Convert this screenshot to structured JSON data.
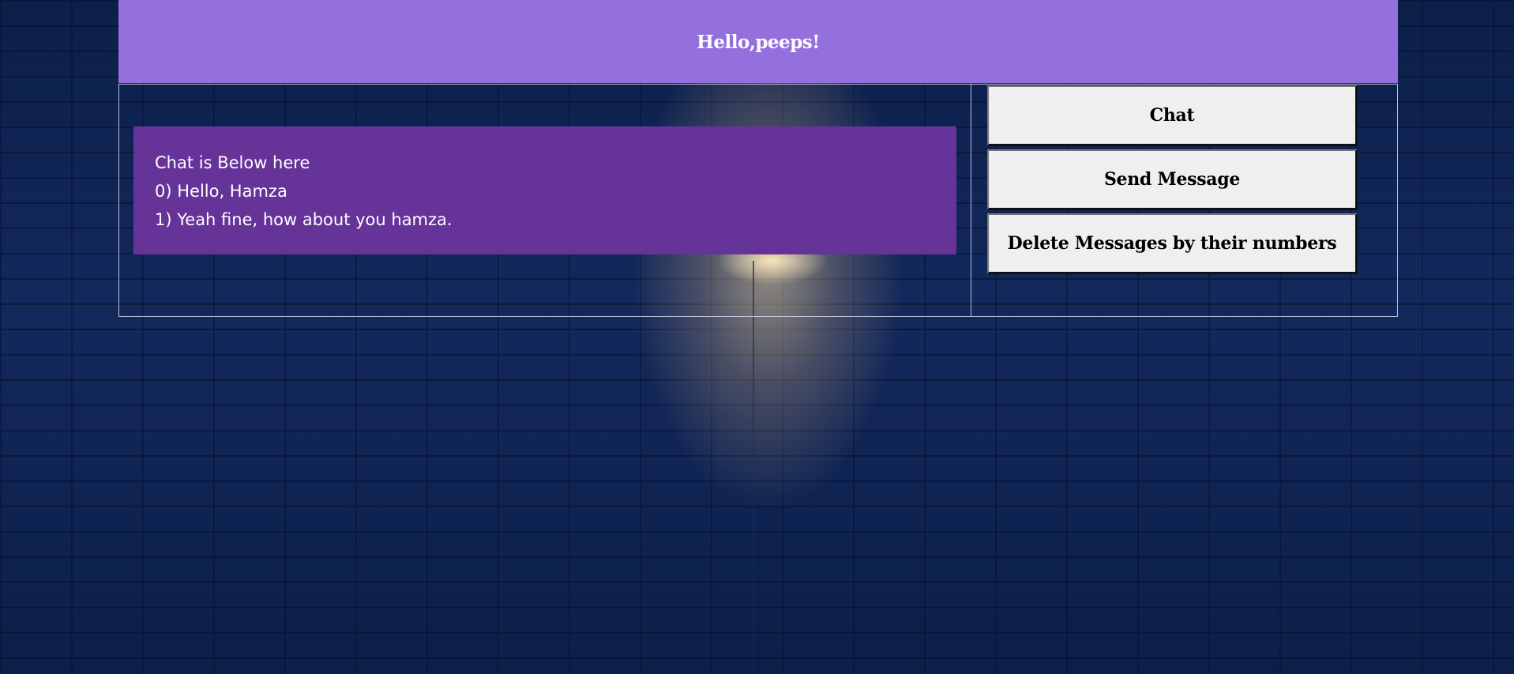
{
  "header": {
    "title": "Hello,peeps!"
  },
  "chat": {
    "lines": [
      "Chat is Below here",
      "0) Hello, Hamza",
      "1) Yeah fine, how about you hamza."
    ]
  },
  "actions": {
    "chat_label": "Chat",
    "send_label": "Send Message",
    "delete_label": "Delete Messages by their numbers"
  },
  "colors": {
    "header_bg": "#9370db",
    "chat_panel_bg": "#663399",
    "button_bg": "#efefef",
    "page_bg": "#0f2350"
  }
}
